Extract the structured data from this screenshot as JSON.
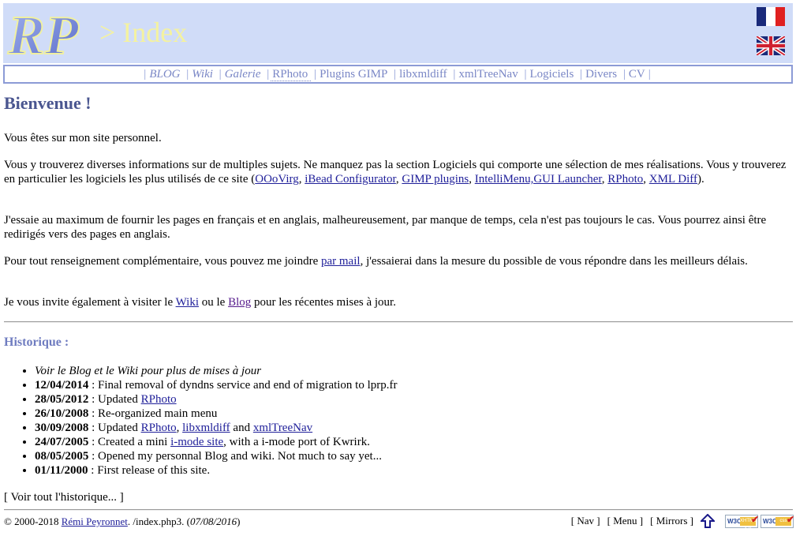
{
  "header": {
    "logo_text": "RP",
    "title": "> Index",
    "flags": [
      {
        "name": "flag-fr",
        "label": "Français"
      },
      {
        "name": "flag-uk",
        "label": "English"
      }
    ]
  },
  "menu": {
    "items": [
      {
        "label": "BLOG",
        "italic": true
      },
      {
        "label": "Wiki",
        "italic": true
      },
      {
        "label": "Galerie",
        "italic": true
      },
      {
        "label": "RPhoto",
        "italic": false
      },
      {
        "label": "Plugins GIMP",
        "italic": false
      },
      {
        "label": "libxmldiff",
        "italic": false
      },
      {
        "label": "xmlTreeNav",
        "italic": false
      },
      {
        "label": "Logiciels",
        "italic": false
      },
      {
        "label": "Divers",
        "italic": false
      },
      {
        "label": "CV",
        "italic": false
      }
    ]
  },
  "main": {
    "heading": "Bienvenue !",
    "p1": "Vous êtes sur mon site personnel.",
    "p2_text": "Vous y trouverez diverses informations sur de multiples sujets. Ne manquez pas la section Logiciels qui comporte une sélection de mes réalisations. Vous y trouverez en particulier les logiciels les plus utilisés de ce site (",
    "p2_links": [
      "OOoVirg",
      "iBead Configurator",
      "GIMP plugins",
      "IntelliMenu,GUI Launcher",
      "RPhoto",
      "XML Diff"
    ],
    "p2_end": ").",
    "p3": "J'essaie au maximum de fournir les pages en français et en anglais, malheureusement, par manque de temps, cela n'est pas toujours le cas. Vous pourrez ainsi être redirigés vers des pages en anglais.",
    "p4_before": "Pour tout renseignement complémentaire, vous pouvez me joindre ",
    "p4_link": "par mail",
    "p4_after": ", j'essaierai dans la mesure du possible de vous répondre dans les meilleurs délais.",
    "p5_before": "Je vous invite également à visiter le ",
    "p5_link1": "Wiki",
    "p5_mid": " ou le ",
    "p5_link2": "Blog",
    "p5_after": " pour les récentes mises à jour."
  },
  "history": {
    "heading": "Historique :",
    "note": "Voir le Blog et le Wiki pour plus de mises à jour",
    "entries": [
      {
        "date": "12/04/2014",
        "sep": " : ",
        "text": "Final removal of dyndns service and end of migration to lprp.fr"
      },
      {
        "date": "28/05/2012",
        "sep": " : ",
        "pre": "Updated ",
        "link1": "RPhoto"
      },
      {
        "date": "26/10/2008",
        "sep": " : ",
        "text": "Re-organized main menu"
      },
      {
        "date": "30/09/2008",
        "sep": " : ",
        "pre": "Updated ",
        "link1": "RPhoto",
        "mid1": ", ",
        "link2": "libxmldiff",
        "mid2": " and ",
        "link3": "xmlTreeNav"
      },
      {
        "date": "24/07/2005",
        "sep": " : ",
        "pre": "Created a mini ",
        "link1": "i-mode site",
        "post": ", with a i-mode port of Kwrirk."
      },
      {
        "date": "08/05/2005",
        "sep": " : ",
        "text": "Opened my personnal Blog and wiki. Not much to say yet..."
      },
      {
        "date": "01/11/2000",
        "sep": " : ",
        "text": "First release of this site."
      }
    ],
    "see_all": "[ Voir tout l'historique... ]"
  },
  "footer": {
    "copyright": "© 2000-2018 ",
    "author": "Rémi Peyronnet",
    "path": ". /index.php3. (",
    "date": "07/08/2016",
    "close": ")",
    "links": [
      "[ Nav ]",
      "[ Menu ]",
      "[ Mirrors ]"
    ],
    "badges": [
      {
        "w3": "W3C",
        "tag": "XHTML 1.0"
      },
      {
        "w3": "W3C",
        "tag": "css"
      }
    ]
  }
}
